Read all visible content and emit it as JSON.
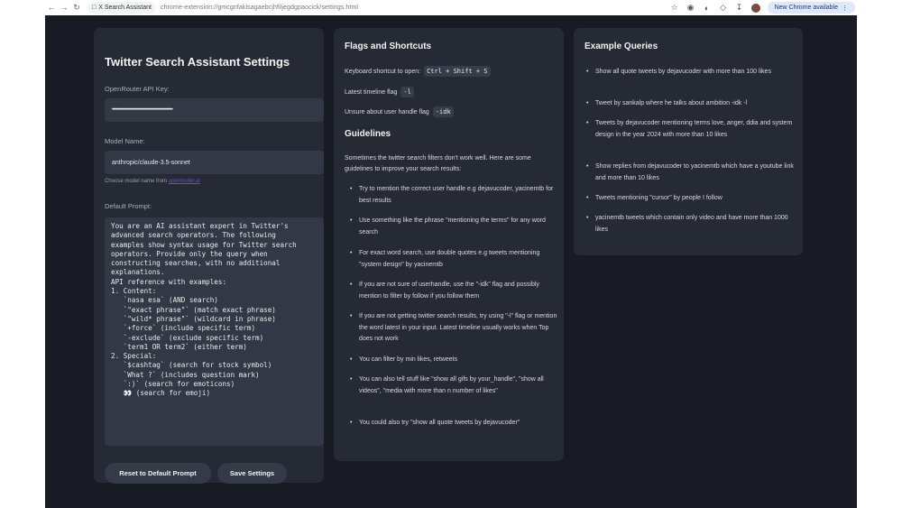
{
  "browser": {
    "tab_title": "X Search Assistant",
    "url": "chrome-extension://gmcgnfaklsagaebcjhfiljegdgpaocick/settings.html",
    "update_label": "New Chrome available"
  },
  "settings": {
    "title": "Twitter Search Assistant Settings",
    "api_key_label": "OpenRouter API Key:",
    "api_key_value": "••••••••••••••••••••••••••••••••••••••••••••••••••••••••••••••••••••••••••",
    "model_label": "Model Name:",
    "model_value": "anthropic/claude-3.5-sonnet",
    "model_hint_prefix": "Choose model name from ",
    "model_hint_link": "openrouter.ai",
    "prompt_label": "Default Prompt:",
    "prompt_text": "You are an AI assistant expert in Twitter's\nadvanced search operators. The following\nexamples show syntax usage for Twitter search\noperators. Provide only the query when\nconstructing searches, with no additional\nexplanations.\nAPI reference with examples:\n1. Content:\n   `nasa esa` (AND search)\n   `\"exact phrase\"` (match exact phrase)\n   `\"wild* phrase\"` (wildcard in phrase)\n   `+force` (include specific term)\n   `-exclude` (exclude specific term)\n   `term1 OR term2` (either term)\n2. Special:\n   `$cashtag` (search for stock symbol)\n   `What ?` (includes question mark)\n   `:)` (search for emoticons)\n   👀 (search for emoji)",
    "reset_label": "Reset to Default Prompt",
    "save_label": "Save Settings"
  },
  "flags": {
    "title": "Flags and Shortcuts",
    "shortcut_label": "Keyboard shortcut to open:",
    "shortcut_value": "Ctrl + Shift + S",
    "latest_label": "Latest timeline flag",
    "latest_value": "-l",
    "unsure_label": "Unsure about user handle flag",
    "unsure_value": "-idk",
    "guidelines_title": "Guidelines",
    "guidelines_intro": "Sometimes the twitter search filters don't work well. Here are some guidelines to improve your search results:",
    "items": [
      "Try to mention the correct user handle e.g dejavucoder, yacinemtb for best results",
      "Use something like the phrase \"mentioning the terms\" for any word search",
      "For exact word search, use double quotes e.g tweets mentioning \"system design\" by yacinemtb",
      "If you are not sure of userhandle, use the \"-idk\" flag and possibly mention to filter by follow if you follow them",
      "If you are not getting twitter search results, try using \"-l\" flag or mention the word latest in your input. Latest timeline usually works when Top does not work",
      "You can filter by min likes, retweets",
      "You can also tell stuff like \"show all gifs by your_handle\", \"show all videos\", \"media with more than n number of likes\"",
      "You could also try \"show all quote tweets by dejavucoder\""
    ]
  },
  "examples": {
    "title": "Example Queries",
    "items": [
      "Show all quote tweets by dejavucoder with more than 100 likes",
      "Tweet by sankalp where he talks about ambition -idk -l",
      "Tweets by dejavucoder mentioning terms love, anger, ddia and system design in the year 2024 with more than 10 likes",
      "Show replies from dejavucoder to yacinemtb which have a youtube link and more than 10 likes",
      "Tweets mentioning \"cursor\" by people I follow",
      "yacinemtb tweets which contain only video and have more than 1000 likes"
    ]
  }
}
